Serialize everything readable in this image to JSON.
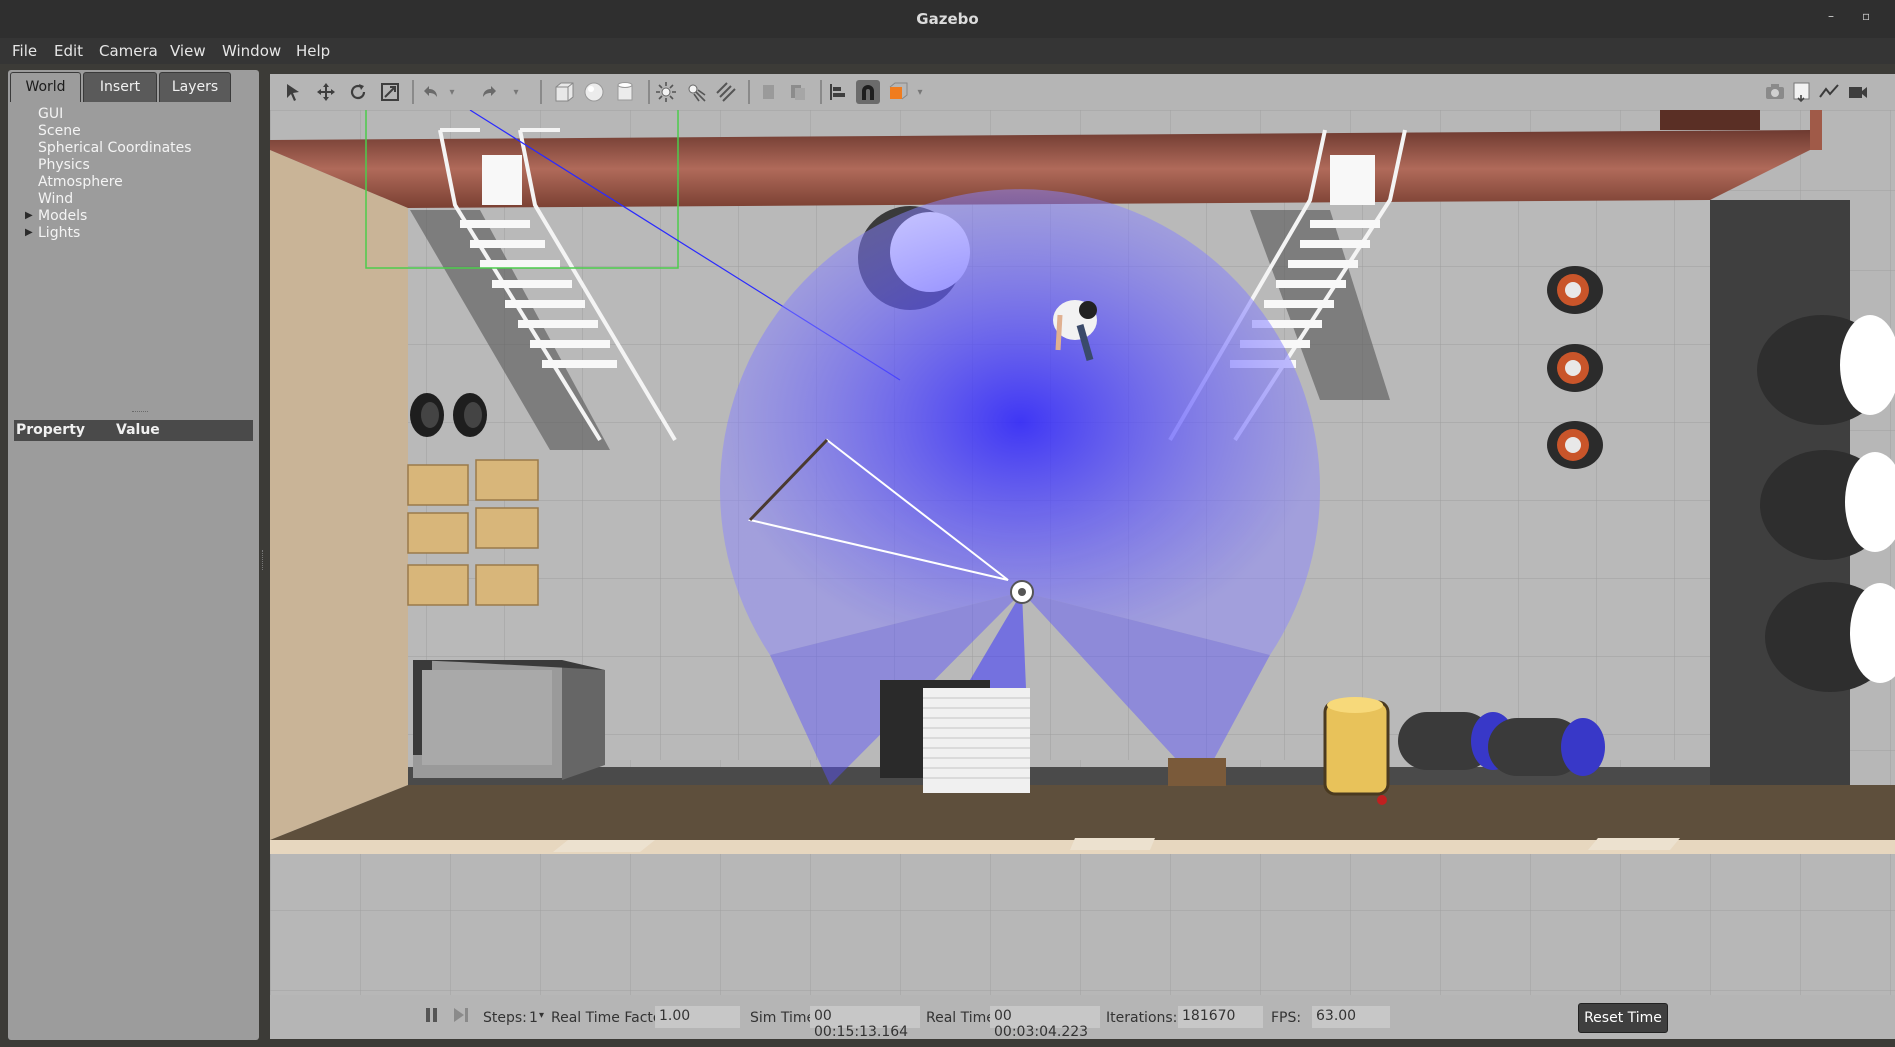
{
  "window": {
    "title": "Gazebo",
    "minimize": "–",
    "restore": "▫"
  },
  "menu": [
    "File",
    "Edit",
    "Camera",
    "View",
    "Window",
    "Help"
  ],
  "left_panel": {
    "tabs": [
      "World",
      "Insert",
      "Layers"
    ],
    "active_tab": "World",
    "tree": [
      "GUI",
      "Scene",
      "Spherical Coordinates",
      "Physics",
      "Atmosphere",
      "Wind",
      "Models",
      "Lights"
    ],
    "property_header": {
      "property": "Property",
      "value": "Value"
    }
  },
  "toolbar": {
    "tools": [
      "select-arrow-icon",
      "translate-icon",
      "rotate-icon",
      "scale-icon",
      "undo-icon",
      "redo-icon",
      "box-icon",
      "sphere-icon",
      "cylinder-icon",
      "point-light-icon",
      "spot-light-icon",
      "directional-light-icon",
      "copy-icon",
      "paste-icon",
      "align-icon",
      "snap-icon",
      "view-angle-icon",
      "screenshot-icon",
      "log-icon",
      "plot-icon",
      "video-record-icon"
    ]
  },
  "bottom": {
    "steps_label": "Steps:",
    "steps_value": "1",
    "rtf_label": "Real Time Factor:",
    "rtf_value": "1.00",
    "sim_time_label": "Sim Time:",
    "sim_time_value": "00 00:15:13.164",
    "real_time_label": "Real Time:",
    "real_time_value": "00 00:03:04.223",
    "iterations_label": "Iterations:",
    "iterations_value": "181670",
    "fps_label": "FPS:",
    "fps_value": "63.00",
    "reset_label": "Reset Time"
  },
  "colors": {
    "laser": "#3a33ff",
    "shelf": "#8a4a3a",
    "floor_wall": "#5e4f3c",
    "tan_wall": "#c9b497"
  }
}
